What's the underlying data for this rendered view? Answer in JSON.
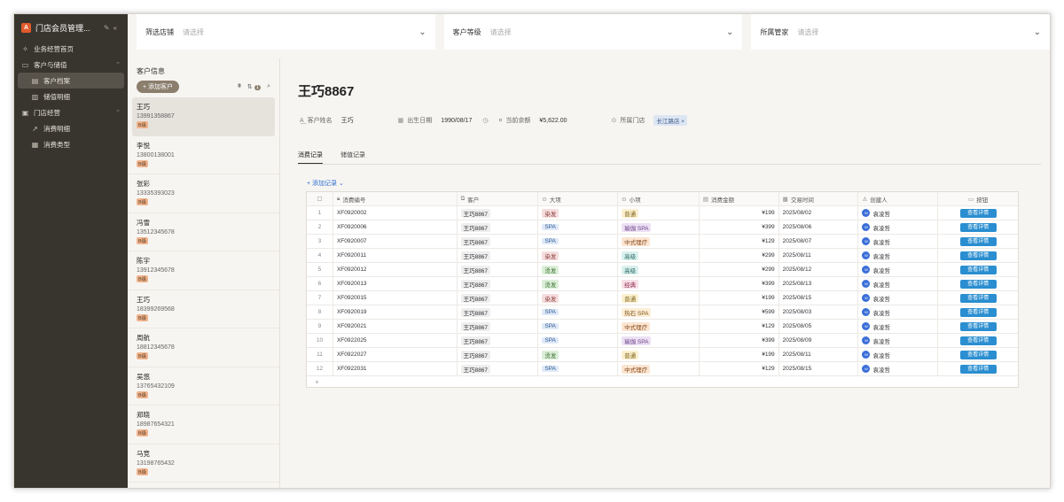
{
  "sidebar": {
    "app_title": "门店会员管理...",
    "logo_letter": "A",
    "items": [
      {
        "label": "业务经营首页",
        "icon": "sparkle-icon",
        "level": 0
      },
      {
        "label": "客户与储值",
        "icon": "monitor-icon",
        "level": 0,
        "expanded": true
      },
      {
        "label": "客户档案",
        "icon": "file-icon",
        "level": 1,
        "active": true
      },
      {
        "label": "储值明细",
        "icon": "chart-icon",
        "level": 1
      },
      {
        "label": "门店经营",
        "icon": "calendar-icon",
        "level": 0,
        "expanded": true
      },
      {
        "label": "消费明细",
        "icon": "trend-icon",
        "level": 1
      },
      {
        "label": "消费类型",
        "icon": "grid-icon",
        "level": 1
      }
    ]
  },
  "filters": [
    {
      "label": "筛选店铺",
      "placeholder": "请选择"
    },
    {
      "label": "客户等级",
      "placeholder": "请选择"
    },
    {
      "label": "所属管家",
      "placeholder": "请选择"
    }
  ],
  "list": {
    "title": "客户信息",
    "add_label": "+ 添加客户",
    "filter_count": "1",
    "customers": [
      {
        "name": "王巧",
        "phone": "13991358867",
        "level": "B级"
      },
      {
        "name": "李悦",
        "phone": "13800138001",
        "level": "B级"
      },
      {
        "name": "张彩",
        "phone": "13335393023",
        "level": "B级"
      },
      {
        "name": "冯雪",
        "phone": "13512345678",
        "level": "B级"
      },
      {
        "name": "陈宇",
        "phone": "13912345678",
        "level": "B级"
      },
      {
        "name": "王巧",
        "phone": "18399269568",
        "level": "B级"
      },
      {
        "name": "周航",
        "phone": "18812345678",
        "level": "B级"
      },
      {
        "name": "吴悠",
        "phone": "13765432109",
        "level": "B级"
      },
      {
        "name": "郑晓",
        "phone": "18987654321",
        "level": "B级"
      },
      {
        "name": "马竞",
        "phone": "13198765432",
        "level": "B级"
      }
    ]
  },
  "detail": {
    "title": "王巧8867",
    "fields": {
      "name_label": "客户姓名",
      "name_value": "王巧",
      "birth_label": "出生日期",
      "birth_value": "1990/08/17",
      "balance_label": "当前余额",
      "balance_value": "¥5,622.00",
      "store_label": "所属门店",
      "store_value": "长江路店"
    },
    "tabs": [
      "消费记录",
      "储值记录"
    ],
    "add_record": "+ 添加记录",
    "columns": [
      "消费编号",
      "客户",
      "大项",
      "小项",
      "消费金额",
      "交易时间",
      "创建人",
      "按钮"
    ],
    "rows": [
      {
        "id": "XF0920002",
        "cust": "王巧8867",
        "cat": "染发",
        "sub": "普通",
        "amt": "¥199",
        "date": "2025/08/02",
        "creator": "袁凌哲",
        "btn": "查看详情"
      },
      {
        "id": "XF0920006",
        "cust": "王巧8867",
        "cat": "SPA",
        "sub": "瑜伽 SPA",
        "amt": "¥399",
        "date": "2025/08/06",
        "creator": "袁凌哲",
        "btn": "查看详情"
      },
      {
        "id": "XF0920007",
        "cust": "王巧8867",
        "cat": "SPA",
        "sub": "中式理疗",
        "amt": "¥129",
        "date": "2025/08/07",
        "creator": "袁凌哲",
        "btn": "查看详情"
      },
      {
        "id": "XF0920011",
        "cust": "王巧8867",
        "cat": "染发",
        "sub": "高级",
        "amt": "¥299",
        "date": "2025/08/11",
        "creator": "袁凌哲",
        "btn": "查看详情"
      },
      {
        "id": "XF0920012",
        "cust": "王巧8867",
        "cat": "烫发",
        "sub": "高级",
        "amt": "¥299",
        "date": "2025/08/12",
        "creator": "袁凌哲",
        "btn": "查看详情"
      },
      {
        "id": "XF0920013",
        "cust": "王巧8867",
        "cat": "烫发",
        "sub": "经典",
        "amt": "¥399",
        "date": "2025/08/13",
        "creator": "袁凌哲",
        "btn": "查看详情"
      },
      {
        "id": "XF0920015",
        "cust": "王巧8867",
        "cat": "染发",
        "sub": "普通",
        "amt": "¥199",
        "date": "2025/08/15",
        "creator": "袁凌哲",
        "btn": "查看详情"
      },
      {
        "id": "XF0920019",
        "cust": "王巧8867",
        "cat": "SPA",
        "sub": "热石 SPA",
        "amt": "¥599",
        "date": "2025/08/03",
        "creator": "袁凌哲",
        "btn": "查看详情"
      },
      {
        "id": "XF0920021",
        "cust": "王巧8867",
        "cat": "SPA",
        "sub": "中式理疗",
        "amt": "¥129",
        "date": "2025/08/05",
        "creator": "袁凌哲",
        "btn": "查看详情"
      },
      {
        "id": "XF0922025",
        "cust": "王巧8867",
        "cat": "SPA",
        "sub": "瑜伽 SPA",
        "amt": "¥399",
        "date": "2025/08/09",
        "creator": "袁凌哲",
        "btn": "查看详情"
      },
      {
        "id": "XF0922027",
        "cust": "王巧8867",
        "cat": "烫发",
        "sub": "普通",
        "amt": "¥199",
        "date": "2025/08/11",
        "creator": "袁凌哲",
        "btn": "查看详情"
      },
      {
        "id": "XF0922031",
        "cust": "王巧8867",
        "cat": "SPA",
        "sub": "中式理疗",
        "amt": "¥129",
        "date": "2025/08/15",
        "creator": "袁凌哲",
        "btn": "查看详情"
      }
    ],
    "chip_colors": {
      "染发": {
        "bg": "#f6dede",
        "fg": "#8a3b3b"
      },
      "SPA": {
        "bg": "#dfe9f7",
        "fg": "#2f5b93"
      },
      "烫发": {
        "bg": "#dcefd8",
        "fg": "#3c6f33"
      },
      "普通": {
        "bg": "#fbf0cf",
        "fg": "#7a5d12"
      },
      "瑜伽 SPA": {
        "bg": "#ece1f4",
        "fg": "#6a3e86"
      },
      "中式理疗": {
        "bg": "#fbe5d2",
        "fg": "#8a4c1c"
      },
      "高级": {
        "bg": "#d9f0ee",
        "fg": "#2d6c66"
      },
      "经典": {
        "bg": "#f9dfe7",
        "fg": "#8d3352"
      },
      "热石 SPA": {
        "bg": "#fdeed7",
        "fg": "#7c5419"
      }
    }
  }
}
